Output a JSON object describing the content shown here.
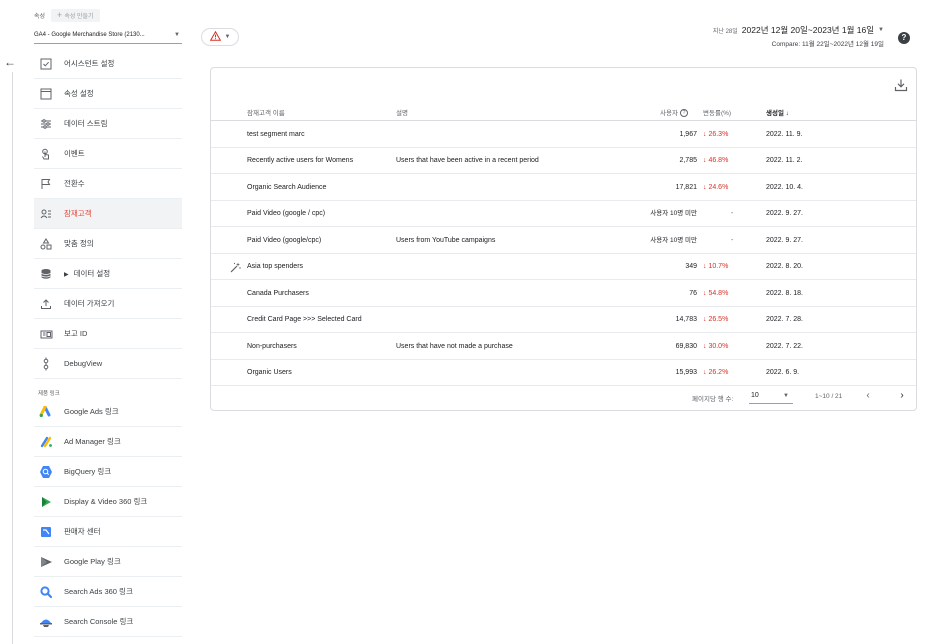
{
  "property": {
    "label": "속성",
    "create_label": "속성 만들기",
    "selected": "GA4 - Google Merchandise Store (2130..."
  },
  "nav": {
    "back_label": "←",
    "items": [
      {
        "label": "어시스턴트 설정",
        "icon": "checkbox-icon"
      },
      {
        "label": "속성 설정",
        "icon": "window-icon"
      },
      {
        "label": "데이터 스트림",
        "icon": "streams-icon"
      },
      {
        "label": "이벤트",
        "icon": "touch-icon"
      },
      {
        "label": "전환수",
        "icon": "flag-icon"
      },
      {
        "label": "잠재고객",
        "icon": "audience-icon"
      },
      {
        "label": "맞춤 정의",
        "icon": "shapes-icon"
      },
      {
        "label": "데이터 설정",
        "icon": "database-icon"
      },
      {
        "label": "데이터 가져오기",
        "icon": "upload-icon"
      },
      {
        "label": "보고 ID",
        "icon": "report-id-icon"
      },
      {
        "label": "DebugView",
        "icon": "debug-icon"
      }
    ],
    "product_links_label": "제품 링크",
    "links": [
      {
        "label": "Google Ads 링크",
        "icon": "google-ads-icon"
      },
      {
        "label": "Ad Manager 링크",
        "icon": "ad-manager-icon"
      },
      {
        "label": "BigQuery 링크",
        "icon": "bigquery-icon"
      },
      {
        "label": "Display & Video 360 링크",
        "icon": "dv360-icon"
      },
      {
        "label": "판매자 센터",
        "icon": "merchant-center-icon"
      },
      {
        "label": "Google Play 링크",
        "icon": "google-play-icon"
      },
      {
        "label": "Search Ads 360 링크",
        "icon": "search-ads-icon"
      },
      {
        "label": "Search Console 링크",
        "icon": "search-console-icon"
      }
    ]
  },
  "header": {
    "date_prefix": "지난 28일",
    "date_range": "2022년 12월 20일~2023년 1월 16일",
    "compare": "Compare: 11월 22일~2022년 12월 19일"
  },
  "table": {
    "columns": {
      "name": "잠재고객 이름",
      "description": "설명",
      "users": "사용자",
      "change": "변동률(%)",
      "created": "생성일 ↓"
    },
    "rows": [
      {
        "name": "test segment marc",
        "description": "",
        "users": "1,967",
        "change": "↓ 26.3%",
        "created": "2022. 11. 9."
      },
      {
        "name": "Recently active users for Womens",
        "description": "Users that have been active in a recent period",
        "users": "2,785",
        "change": "↓ 46.8%",
        "created": "2022. 11. 2."
      },
      {
        "name": "Organic Search Audience",
        "description": "",
        "users": "17,821",
        "change": "↓ 24.6%",
        "created": "2022. 10. 4."
      },
      {
        "name": "Paid Video (google / cpc)",
        "description": "",
        "users": "사용자 10명 미만",
        "change": "-",
        "created": "2022. 9. 27."
      },
      {
        "name": "Paid Video (google/cpc)",
        "description": "Users from YouTube campaigns",
        "users": "사용자 10명 미만",
        "change": "-",
        "created": "2022. 9. 27."
      },
      {
        "name": "Asia top spenders",
        "description": "",
        "users": "349",
        "change": "↓ 10.7%",
        "created": "2022. 8. 20."
      },
      {
        "name": "Canada Purchasers",
        "description": "",
        "users": "76",
        "change": "↓ 54.8%",
        "created": "2022. 8. 18."
      },
      {
        "name": "Credit Card Page >>> Selected Card",
        "description": "",
        "users": "14,783",
        "change": "↓ 26.5%",
        "created": "2022. 7. 28."
      },
      {
        "name": "Non-purchasers",
        "description": "Users that have not made a purchase",
        "users": "69,830",
        "change": "↓ 30.0%",
        "created": "2022. 7. 22."
      },
      {
        "name": "Organic Users",
        "description": "",
        "users": "15,993",
        "change": "↓ 26.2%",
        "created": "2022. 6. 9."
      }
    ],
    "pager": {
      "rows_per_page_label": "페이지당 행 수:",
      "rows_per_page": "10",
      "range": "1~10 / 21"
    }
  },
  "colors": {
    "accent_red": "#e8453c",
    "negative": "#d93025",
    "border": "#dadce0"
  }
}
